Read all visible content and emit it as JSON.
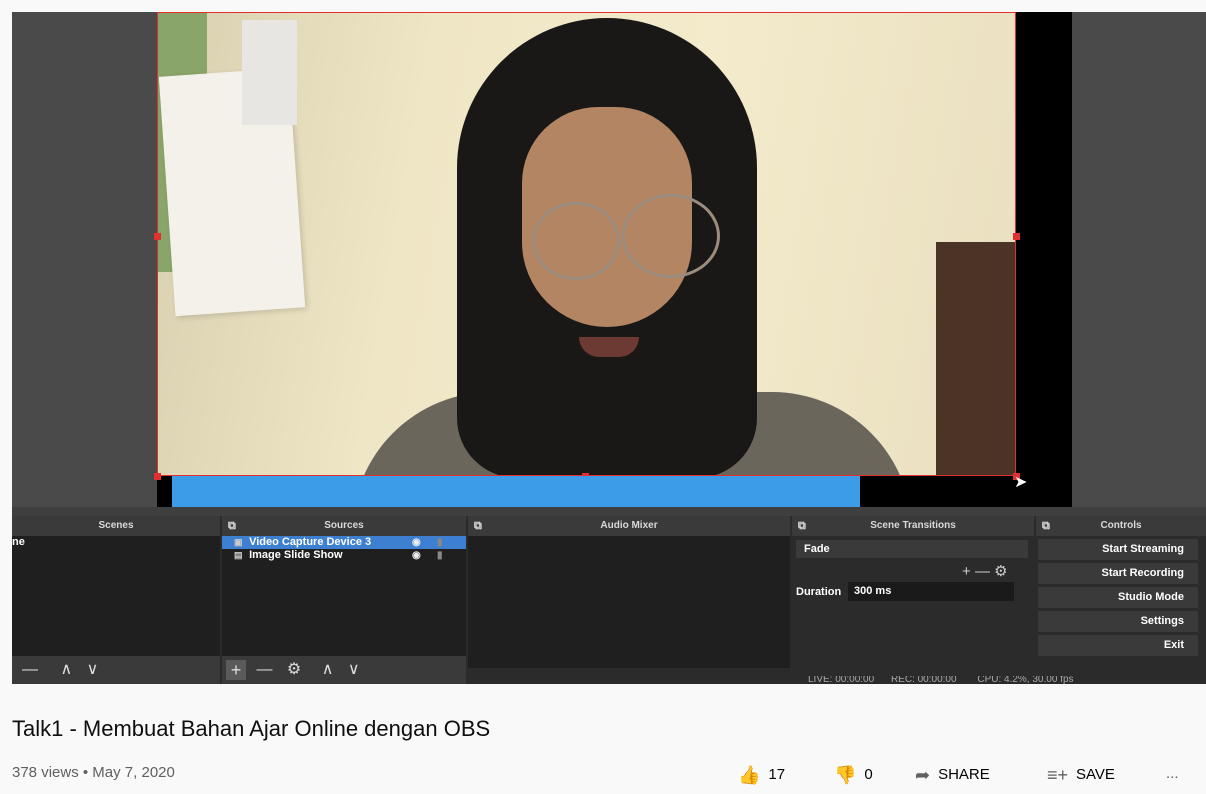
{
  "obs": {
    "panels": {
      "scenes": "Scenes",
      "sources": "Sources",
      "audio_mixer": "Audio Mixer",
      "scene_transitions": "Scene Transitions",
      "controls": "Controls"
    },
    "scenes_item_partial": "ne",
    "sources": [
      {
        "label": "Video Capture Device 3",
        "selected": true
      },
      {
        "label": "Image Slide Show",
        "selected": false
      }
    ],
    "transition": {
      "selected": "Fade",
      "duration_label": "Duration",
      "duration_value": "300 ms"
    },
    "controls": [
      "Start Streaming",
      "Start Recording",
      "Studio Mode",
      "Settings",
      "Exit"
    ],
    "status": {
      "live": "LIVE: 00:00:00",
      "rec": "REC: 00:00:00",
      "cpu": "CPU: 4.2%, 30.00 fps"
    },
    "accent": "#3c9ce8",
    "selection_color": "#e03030"
  },
  "video": {
    "title": "Talk1 - Membuat Bahan Ajar Online dengan OBS",
    "meta": "378 views • May 7, 2020",
    "likes": "17",
    "dislikes": "0",
    "share_label": "SHARE",
    "save_label": "SAVE",
    "more_label": "..."
  }
}
